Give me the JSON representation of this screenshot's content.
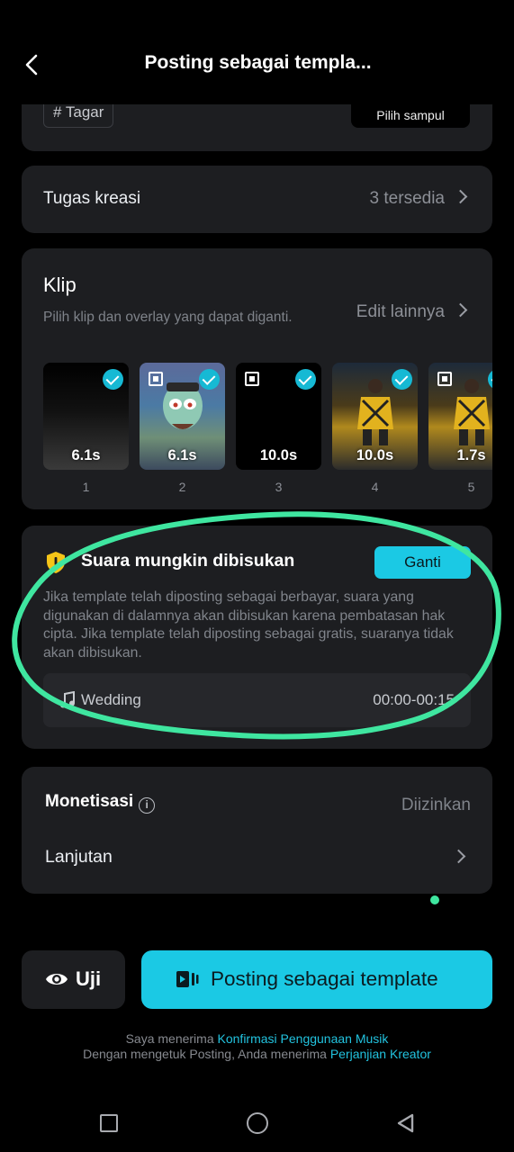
{
  "header": {
    "title": "Posting sebagai templa..."
  },
  "top_card": {
    "tag_label": "# Tagar",
    "cover_button": "Pilih sampul"
  },
  "tugas": {
    "label": "Tugas kreasi",
    "value": "3 tersedia"
  },
  "klip": {
    "title": "Klip",
    "description": "Pilih klip dan overlay yang dapat diganti.",
    "edit_link": "Edit lainnya",
    "clips": [
      {
        "duration": "6.1s",
        "number": "1",
        "checked": true,
        "overlay": false
      },
      {
        "duration": "6.1s",
        "number": "2",
        "checked": true,
        "overlay": true
      },
      {
        "duration": "10.0s",
        "number": "3",
        "checked": true,
        "overlay": true
      },
      {
        "duration": "10.0s",
        "number": "4",
        "checked": true,
        "overlay": false
      },
      {
        "duration": "1.7s",
        "number": "5",
        "checked": true,
        "overlay": true
      }
    ]
  },
  "suara": {
    "title": "Suara mungkin dibisukan",
    "button": "Ganti",
    "body": "Jika template telah diposting sebagai berbayar, suara yang digunakan di dalamnya akan dibisukan karena pembatasan hak cipta. Jika template telah diposting sebagai gratis, suaranya tidak akan dibisukan.",
    "music_name": "Wedding",
    "music_time": "00:00-00:15"
  },
  "monetisasi": {
    "title": "Monetisasi",
    "value": "Diizinkan",
    "lanjutan": "Lanjutan"
  },
  "actions": {
    "uji": "Uji",
    "post": "Posting sebagai template"
  },
  "terms": {
    "line1_prefix": "Saya menerima ",
    "line1_link": "Konfirmasi Penggunaan Musik",
    "line2_prefix": "Dengan mengetuk Posting, Anda menerima ",
    "line2_link": "Perjanjian Kreator"
  },
  "colors": {
    "accent": "#1bc9e4",
    "card": "#1d1e21",
    "annotation": "#3fe6a0",
    "warning": "#f5c518"
  }
}
